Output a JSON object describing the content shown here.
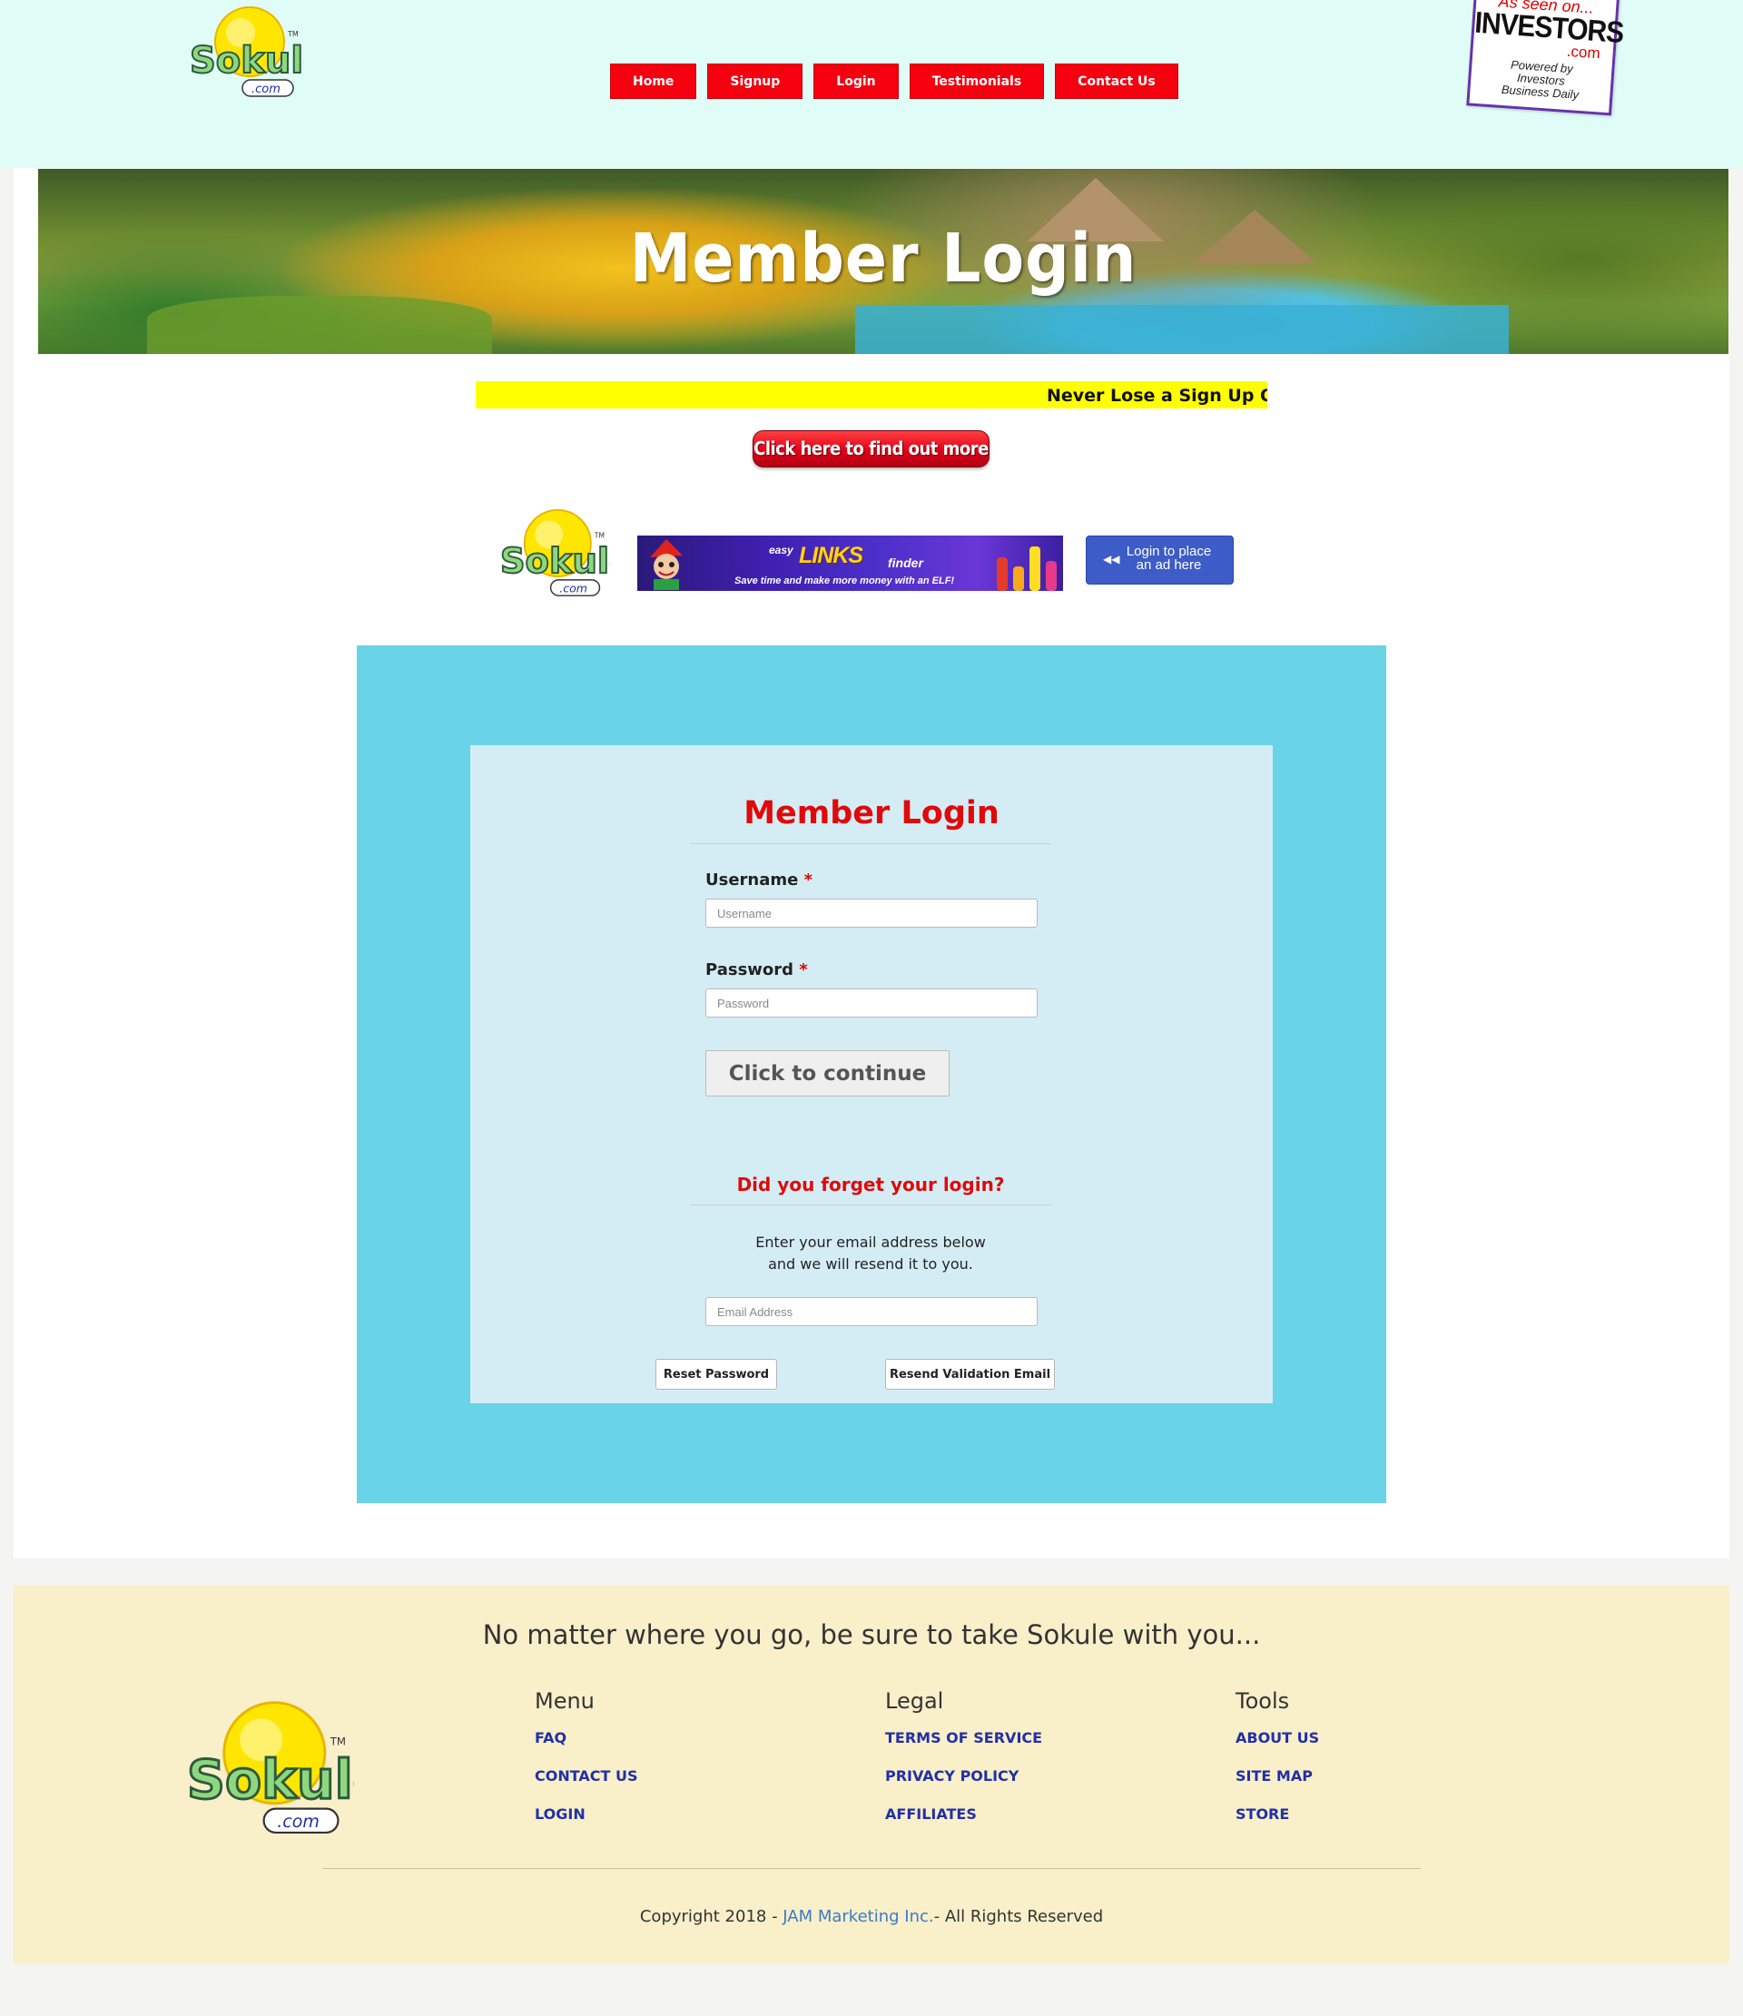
{
  "header": {
    "logo": {
      "word": "Sokule",
      "tm": "TM",
      "dotcom": ".com"
    },
    "nav": [
      {
        "label": "Home"
      },
      {
        "label": "Signup"
      },
      {
        "label": "Login"
      },
      {
        "label": "Testimonials"
      },
      {
        "label": "Contact Us"
      }
    ],
    "investors_badge": {
      "seen": "As seen on...",
      "name": "INVESTORS",
      "dotcom": ".com",
      "powered": "Powered by",
      "powered2": "Investors",
      "powered3": "Business Daily"
    }
  },
  "banner": {
    "title": "Member Login"
  },
  "ticker": {
    "text": "Never Lose a Sign Up Or Sale Again!"
  },
  "find_out_button": {
    "label": "Click here to find out more"
  },
  "ad": {
    "easy": "easy",
    "links": "LINKS",
    "finder": "finder",
    "tagline": "Save time and make more money with an ELF!"
  },
  "place_ad_button": {
    "line1": "Login to place",
    "line2": "an ad here",
    "icon": "double-left-arrow-icon"
  },
  "login_form": {
    "title": "Member Login",
    "username_label": "Username",
    "username_placeholder": "Username",
    "username_value": "",
    "password_label": "Password",
    "password_placeholder": "Password",
    "password_value": "",
    "required_marker": "*",
    "continue_label": "Click to continue"
  },
  "forgot": {
    "title": "Did you forget your login?",
    "line1": "Enter your email address below",
    "line2": "and we will resend it to you.",
    "email_placeholder": "Email Address",
    "email_value": "",
    "reset_label": "Reset Password",
    "resend_label": "Resend Validation Email"
  },
  "footer": {
    "tagline": "No matter where you go, be sure to take Sokule with you...",
    "columns": [
      {
        "heading": "Menu",
        "links": [
          "FAQ",
          "CONTACT US",
          "LOGIN"
        ]
      },
      {
        "heading": "Legal",
        "links": [
          "TERMS OF SERVICE",
          "PRIVACY POLICY",
          "AFFILIATES"
        ]
      },
      {
        "heading": "Tools",
        "links": [
          "ABOUT US",
          "SITE MAP",
          "STORE"
        ]
      }
    ],
    "copyright_prefix": "Copyright 2018 - ",
    "copyright_link": "JAM Marketing Inc.",
    "copyright_suffix": "- All Rights Reserved"
  },
  "colors": {
    "header_bg": "#e0fcf6",
    "nav_red": "#f4000f",
    "login_title_red": "#e00a0a",
    "outer_box": "#69d3e8",
    "inner_box": "#d4edf5",
    "footer_bg": "#f9efc9",
    "footer_link": "#2130a8",
    "ticker_bg": "#ffff00"
  }
}
